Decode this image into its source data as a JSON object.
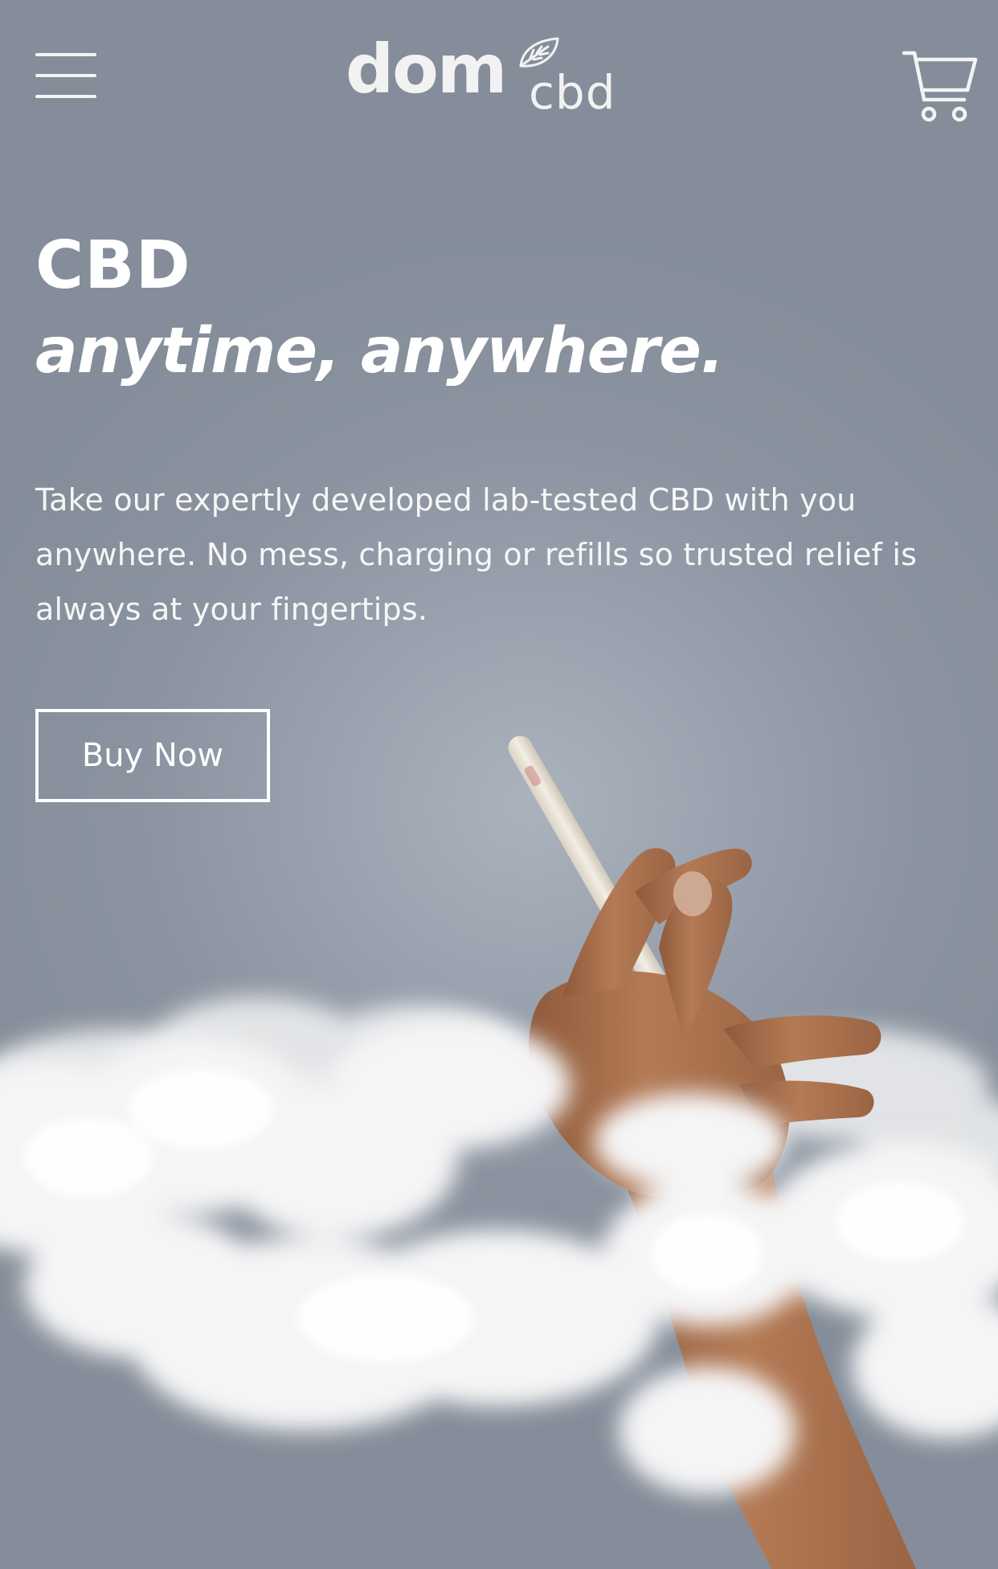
{
  "header": {
    "menu_icon": "hamburger-menu-icon",
    "logo": {
      "main": "dom",
      "sub": "cbd",
      "leaf_icon": "leaf-icon"
    },
    "cart_icon": "shopping-cart-icon"
  },
  "hero": {
    "title": "CBD",
    "subtitle": "anytime, anywhere.",
    "description": "Take our expertly developed lab-tested CBD with you anywhere. No mess, charging or refills so trusted relief is always at your fingertips.",
    "cta_label": "Buy Now",
    "image_subject": "hand-holding-cbd-stick-in-clouds"
  },
  "colors": {
    "background": "#8d96a2",
    "text": "#ffffff",
    "product": "#ece6da",
    "skin": "#a9704c",
    "cloud": "#f4f4f4"
  }
}
